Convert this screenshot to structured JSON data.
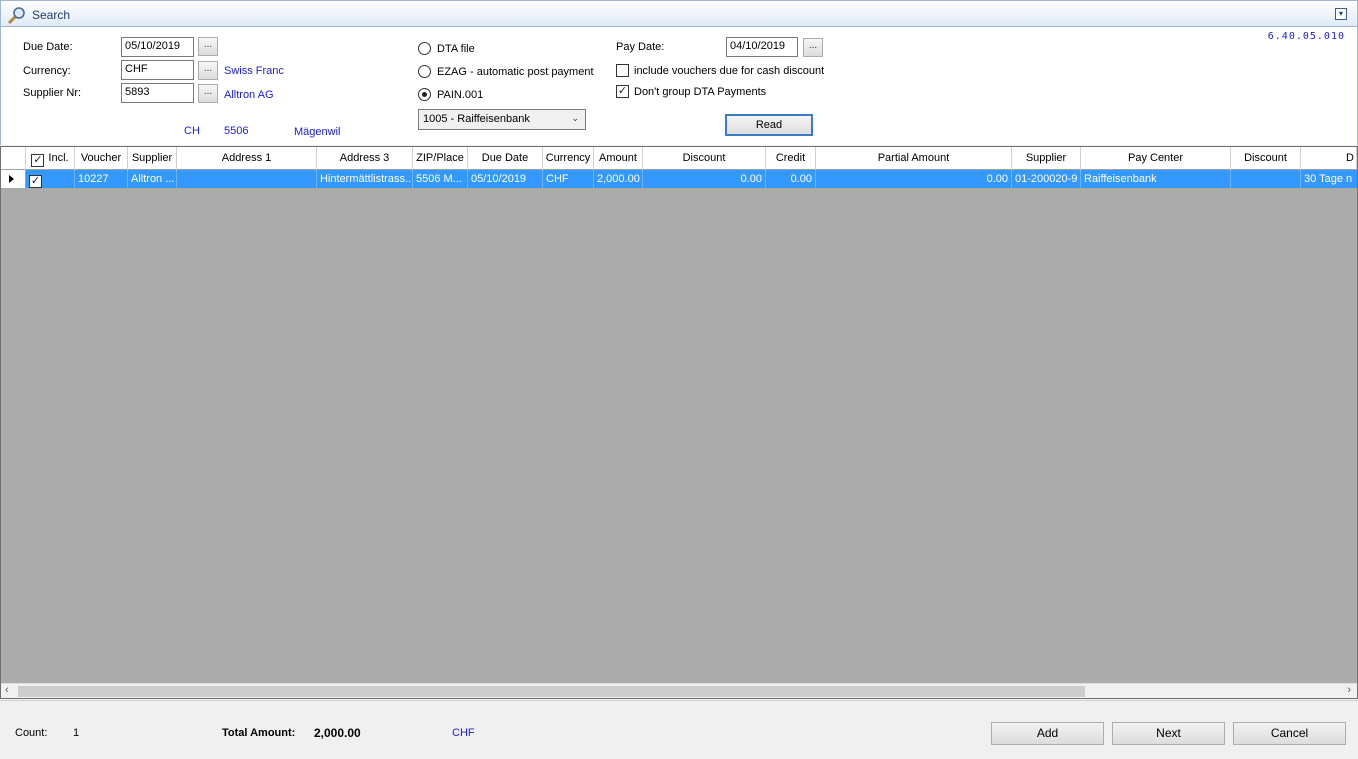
{
  "window": {
    "title": "Search",
    "version": "6.40.05.010"
  },
  "form": {
    "due_date_label": "Due Date:",
    "due_date_value": "05/10/2019",
    "currency_label": "Currency:",
    "currency_value": "CHF",
    "currency_name": "Swiss Franc",
    "supplier_label": "Supplier Nr:",
    "supplier_value": "5893",
    "supplier_name": "Alltron AG",
    "country": "CH",
    "zip": "5506",
    "city": "Mägenwil",
    "browse_label": "...",
    "payment_options": [
      "DTA file",
      "EZAG - automatic post payment",
      "PAIN.001"
    ],
    "selected_payment": "PAIN.001",
    "bank_select": "1005 - Raiffeisenbank",
    "pay_date_label": "Pay Date:",
    "pay_date_value": "04/10/2019",
    "include_cash_discount_label": "include vouchers due for cash discount",
    "include_cash_discount_checked": false,
    "dont_group_label": "Don't group DTA Payments",
    "dont_group_checked": true,
    "read_button": "Read"
  },
  "grid": {
    "columns": [
      "Incl.",
      "Voucher",
      "Supplier",
      "Address 1",
      "Address 3",
      "ZIP/Place",
      "Due Date",
      "Currency",
      "Amount",
      "Discount",
      "Credit",
      "Partial Amount",
      "Supplier",
      "Pay Center",
      "Discount",
      "D"
    ],
    "rows": [
      {
        "incl": true,
        "voucher": "10227",
        "supplier": "Alltron ...",
        "address1": "",
        "address3": "Hintermättlistrass...",
        "zip_place": "5506 M...",
        "due_date": "05/10/2019",
        "currency": "CHF",
        "amount": "2,000.00",
        "discount": "0.00",
        "credit": "0.00",
        "partial_amount": "0.00",
        "supplier_account": "01-200020-9",
        "pay_center": "Raiffeisenbank",
        "discount2": "",
        "terms": "30 Tage n"
      }
    ]
  },
  "footer": {
    "count_label": "Count:",
    "count_value": "1",
    "total_label": "Total Amount:",
    "total_value": "2,000.00",
    "total_currency": "CHF",
    "add_button": "Add",
    "next_button": "Next",
    "cancel_button": "Cancel"
  }
}
